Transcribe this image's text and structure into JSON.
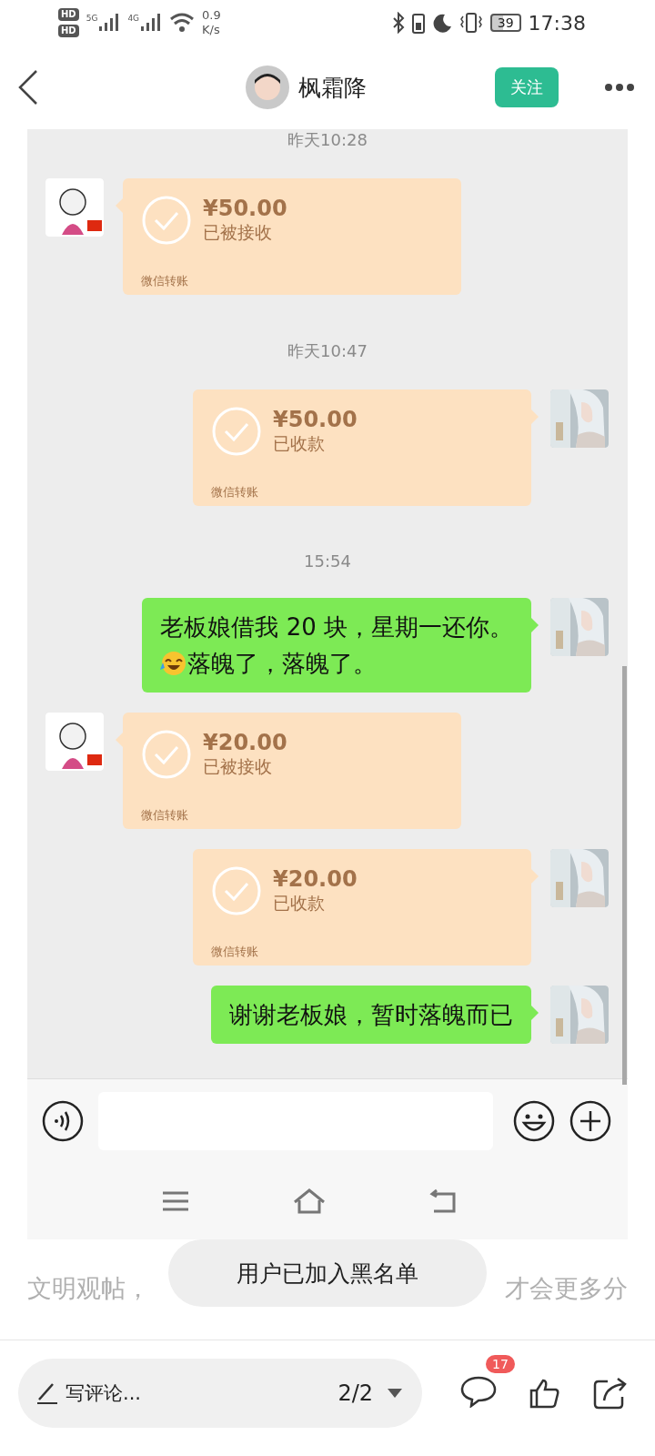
{
  "status_bar": {
    "sim_labels": [
      "HD",
      "HD"
    ],
    "networks": [
      "5G",
      "4G"
    ],
    "speed": "0.9",
    "speed_unit": "K/s",
    "battery": "39",
    "time": "17:38"
  },
  "header": {
    "name": "枫霜降",
    "follow_label": "关注"
  },
  "chat": {
    "messages": [
      {
        "kind": "time",
        "text": "昨天10:28"
      },
      {
        "kind": "transfer",
        "outgoing": false,
        "amount": "¥50.00",
        "status": "已被接收",
        "label": "微信转账"
      },
      {
        "kind": "time",
        "text": "昨天10:47"
      },
      {
        "kind": "transfer",
        "outgoing": true,
        "amount": "¥50.00",
        "status": "已收款",
        "label": "微信转账"
      },
      {
        "kind": "time",
        "text": "15:54"
      },
      {
        "kind": "text",
        "outgoing": true,
        "lines": [
          {
            "text": "老板娘借我 20 块，星期一还你。",
            "emoji": false
          },
          {
            "text": "落魄了，落魄了。",
            "emoji": true
          }
        ]
      },
      {
        "kind": "transfer",
        "outgoing": false,
        "amount": "¥20.00",
        "status": "已被接收",
        "label": "微信转账"
      },
      {
        "kind": "transfer",
        "outgoing": true,
        "amount": "¥20.00",
        "status": "已收款",
        "label": "微信转账"
      },
      {
        "kind": "text",
        "outgoing": true,
        "lines": [
          {
            "text": "谢谢老板娘，暂时落魄而已",
            "emoji": false
          }
        ]
      }
    ]
  },
  "notice_parts": [
    "文明观帖，",
    "才会更多分"
  ],
  "toast": "用户已加入黑名单",
  "bottom_bar": {
    "comment_placeholder": "写评论...",
    "page": "2/2",
    "comment_count": "17"
  }
}
